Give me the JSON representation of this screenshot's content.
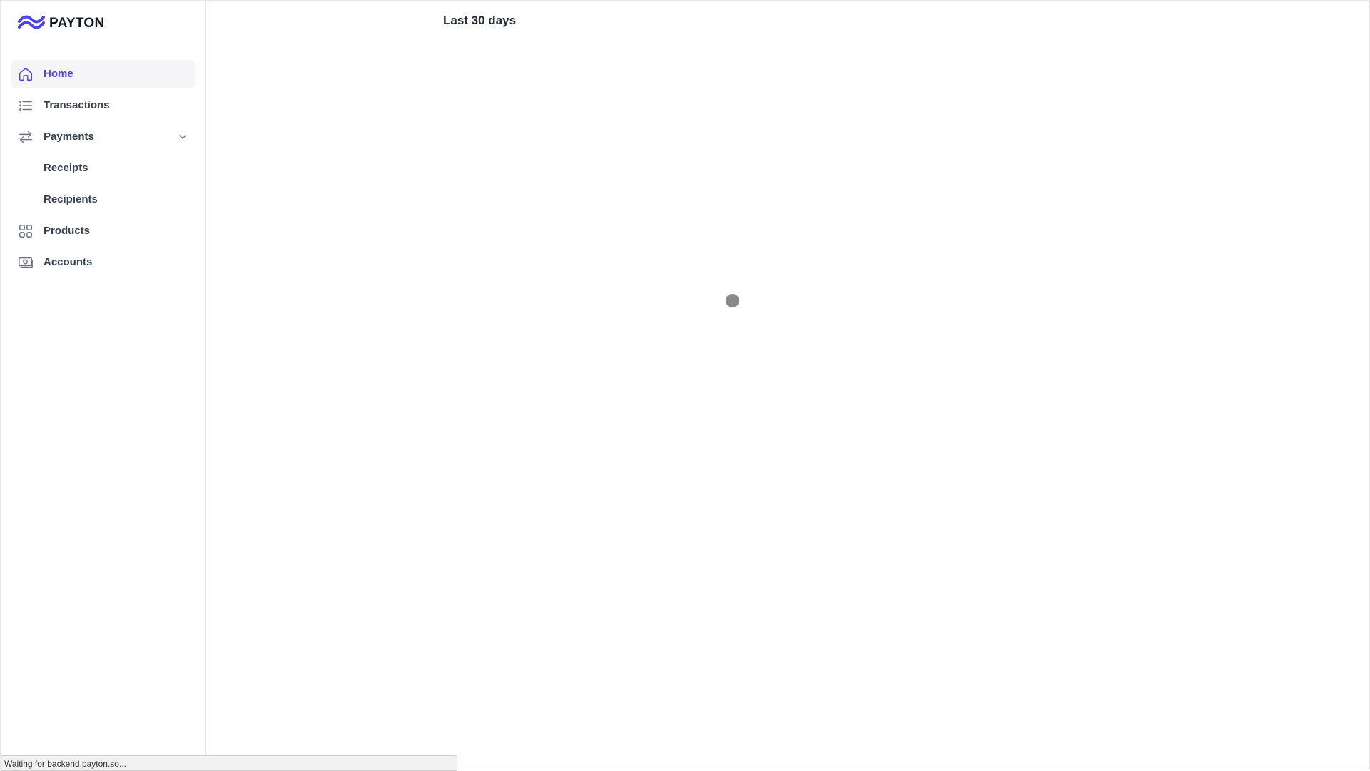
{
  "app": {
    "brand_name": "PAYTON",
    "brand_color": "#4f46e5"
  },
  "sidebar": {
    "items": [
      {
        "label": "Home",
        "icon": "home-icon",
        "active": true
      },
      {
        "label": "Transactions",
        "icon": "list-icon"
      },
      {
        "label": "Payments",
        "icon": "arrows-exchange-icon",
        "expanded": true
      },
      {
        "label": "Receipts"
      },
      {
        "label": "Recipients"
      },
      {
        "label": "Products",
        "icon": "grid-icon"
      },
      {
        "label": "Accounts",
        "icon": "banknote-icon"
      }
    ]
  },
  "main": {
    "period_label": "Last 30 days"
  },
  "status_bar": {
    "text": "Waiting for backend.payton.so..."
  }
}
